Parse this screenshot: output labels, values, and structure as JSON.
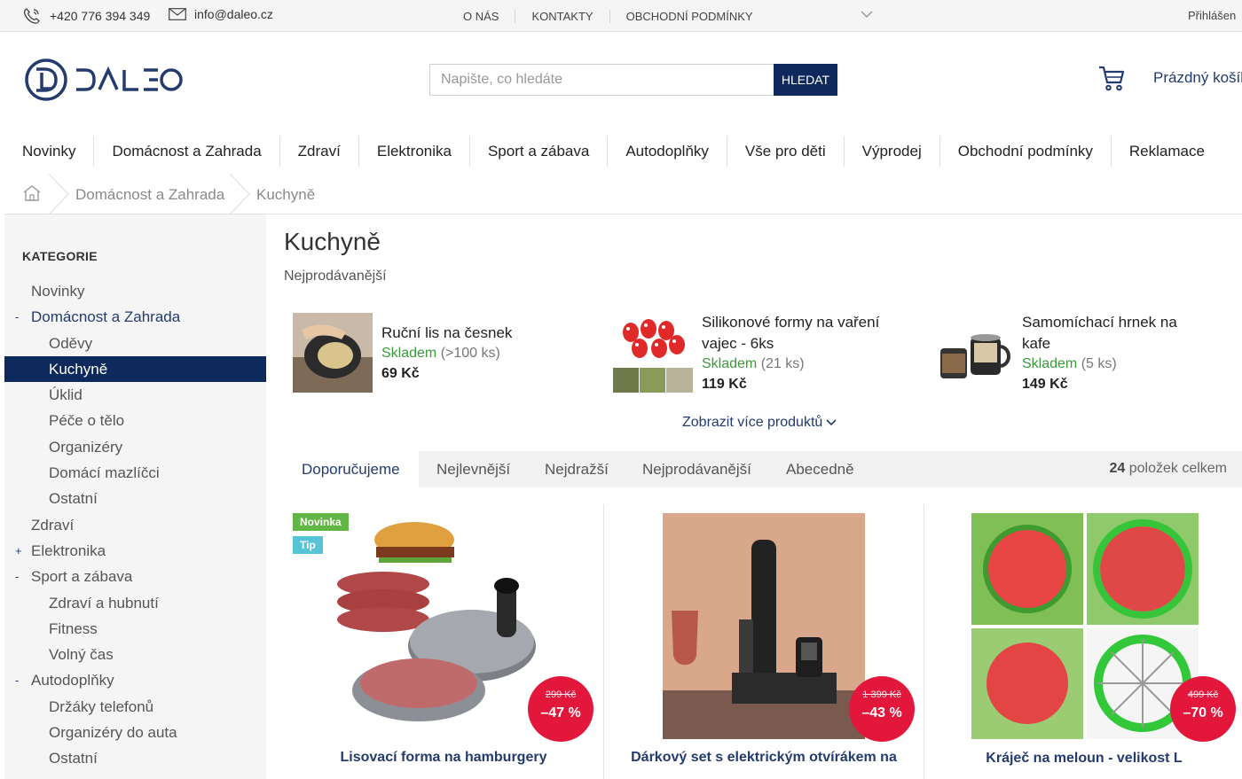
{
  "topbar": {
    "phone": "+420 776 394 349",
    "email": "info@daleo.cz",
    "links": [
      "O NÁS",
      "KONTAKTY",
      "OBCHODNÍ PODMÍNKY"
    ],
    "login": "Přihlášen"
  },
  "header": {
    "search_placeholder": "Napište, co hledáte",
    "search_button": "HLEDAT",
    "cart_label": "Prázdný košík"
  },
  "nav": [
    "Novinky",
    "Domácnost a Zahrada",
    "Zdraví",
    "Elektronika",
    "Sport a zábava",
    "Autodoplňky",
    "Vše pro děti",
    "Výprodej",
    "Obchodní podmínky",
    "Reklamace"
  ],
  "breadcrumb": [
    "Domácnost a Zahrada",
    "Kuchyně"
  ],
  "sidebar": {
    "heading": "KATEGORIE",
    "items": [
      {
        "label": "Novinky",
        "toggle": ""
      },
      {
        "label": "Domácnost a Zahrada",
        "toggle": "-"
      },
      {
        "label": "Oděvy",
        "toggle": ""
      },
      {
        "label": "Kuchyně",
        "toggle": ""
      },
      {
        "label": "Úklid",
        "toggle": ""
      },
      {
        "label": "Péče o tělo",
        "toggle": ""
      },
      {
        "label": "Organizéry",
        "toggle": ""
      },
      {
        "label": "Domácí mazlíčci",
        "toggle": ""
      },
      {
        "label": "Ostatní",
        "toggle": ""
      },
      {
        "label": "Zdraví",
        "toggle": ""
      },
      {
        "label": "Elektronika",
        "toggle": "+"
      },
      {
        "label": "Sport a zábava",
        "toggle": "-"
      },
      {
        "label": "Zdraví a hubnutí",
        "toggle": ""
      },
      {
        "label": "Fitness",
        "toggle": ""
      },
      {
        "label": "Volný čas",
        "toggle": ""
      },
      {
        "label": "Autodoplňky",
        "toggle": "-"
      },
      {
        "label": "Držáky telefonů",
        "toggle": ""
      },
      {
        "label": "Organizéry do auta",
        "toggle": ""
      },
      {
        "label": "Ostatní",
        "toggle": ""
      }
    ]
  },
  "main": {
    "title": "Kuchyně",
    "subtitle": "Nejprodávanější",
    "bestsellers": [
      {
        "name": "Ruční lis na česnek",
        "stock_status": "Skladem",
        "stock_qty": "(>100 ks)",
        "price": "69 Kč"
      },
      {
        "name_line1": "Silikonové formy na vaření",
        "name_line2": "vajec - 6ks",
        "stock_status": "Skladem",
        "stock_qty": "(21 ks)",
        "price": "119 Kč"
      },
      {
        "name_line1": "Samomíchací hrnek na",
        "name_line2": "kafe",
        "stock_status": "Skladem",
        "stock_qty": "(5 ks)",
        "price": "149 Kč"
      }
    ],
    "show_more": "Zobrazit více produktů",
    "sort_tabs": [
      "Doporučujeme",
      "Nejlevnější",
      "Nejdražší",
      "Nejprodávanější",
      "Abecedně"
    ],
    "count_number": "24",
    "count_label": "položek celkem",
    "products": [
      {
        "title": "Lisovací forma na hamburgery",
        "old_price": "299 Kč",
        "discount": "–47 %",
        "badges": [
          "Novinka",
          "Tip"
        ]
      },
      {
        "title": "Dárkový set s elektrickým otvírákem na",
        "old_price": "1 399 Kč",
        "discount": "–43 %",
        "badges": []
      },
      {
        "title": "Kráječ na meloun - velikost L",
        "old_price": "499 Kč",
        "discount": "–70 %",
        "badges": []
      }
    ]
  },
  "colors": {
    "brand_navy": "#0e2a5c",
    "link_blue": "#233b6e",
    "stock_green": "#3a9a3a",
    "discount_red": "#e3173b",
    "badge_new": "#62b645",
    "badge_tip": "#56c3d6"
  }
}
